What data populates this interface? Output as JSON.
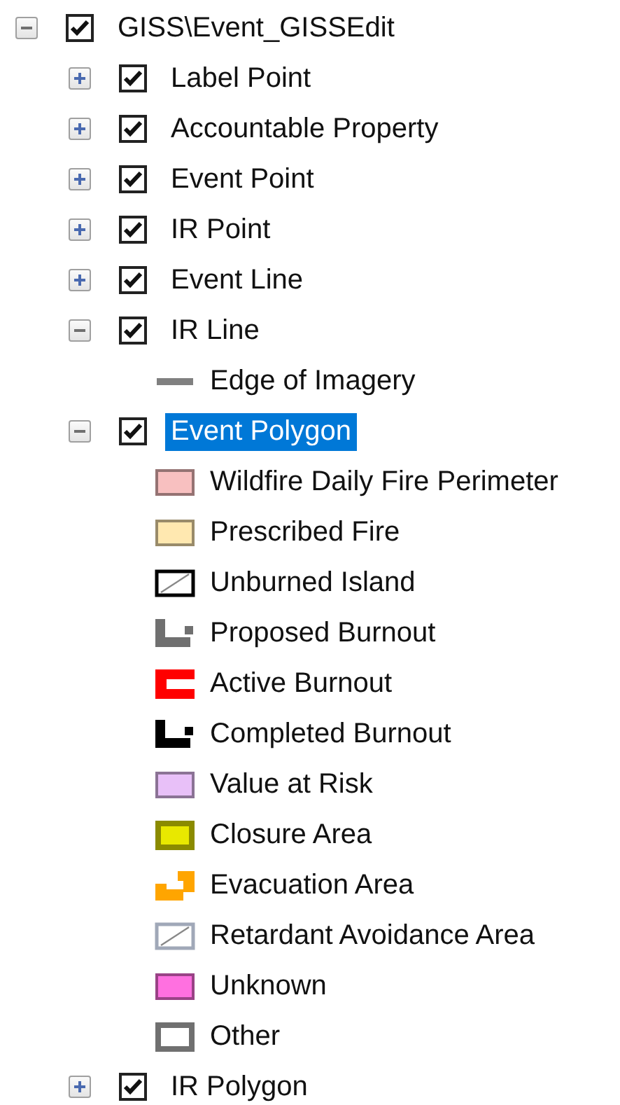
{
  "tree": {
    "label": "GISS\\Event_GISSEdit",
    "checked": true,
    "expanded": true,
    "selected": false,
    "children": [
      {
        "label": "Label Point",
        "checked": true,
        "expanded": false,
        "selected": false
      },
      {
        "label": "Accountable Property",
        "checked": true,
        "expanded": false,
        "selected": false
      },
      {
        "label": "Event Point",
        "checked": true,
        "expanded": false,
        "selected": false
      },
      {
        "label": "IR Point",
        "checked": true,
        "expanded": false,
        "selected": false
      },
      {
        "label": "Event Line",
        "checked": true,
        "expanded": false,
        "selected": false
      },
      {
        "label": "IR Line",
        "checked": true,
        "expanded": true,
        "selected": false,
        "legend": [
          {
            "label": "Edge of Imagery",
            "kind": "line",
            "color": "#808080"
          }
        ]
      },
      {
        "label": "Event Polygon",
        "checked": true,
        "expanded": true,
        "selected": true,
        "legend": [
          {
            "label": "Wildfire Daily Fire Perimeter",
            "kind": "fill",
            "color": "#f8c0c0"
          },
          {
            "label": "Prescribed Fire",
            "kind": "fill",
            "color": "#ffe8b0"
          },
          {
            "label": "Unburned Island",
            "kind": "hatch",
            "color": "#000000"
          },
          {
            "label": "Proposed Burnout",
            "kind": "bracket",
            "color": "#707070"
          },
          {
            "label": "Active Burnout",
            "kind": "cup",
            "color": "#ff0000"
          },
          {
            "label": "Completed Burnout",
            "kind": "bracket",
            "color": "#000000"
          },
          {
            "label": "Value at Risk",
            "kind": "fill",
            "color": "#e8c0f8"
          },
          {
            "label": "Closure Area",
            "kind": "thick",
            "color": "#e8e800"
          },
          {
            "label": "Evacuation Area",
            "kind": "step",
            "color": "#ffa500"
          },
          {
            "label": "Retardant Avoidance Area",
            "kind": "hatch",
            "color": "#a0a8b8"
          },
          {
            "label": "Unknown",
            "kind": "fill",
            "color": "#ff70e0"
          },
          {
            "label": "Other",
            "kind": "frame",
            "color": "#707070"
          }
        ]
      },
      {
        "label": "IR Polygon",
        "checked": true,
        "expanded": false,
        "selected": false
      }
    ]
  }
}
